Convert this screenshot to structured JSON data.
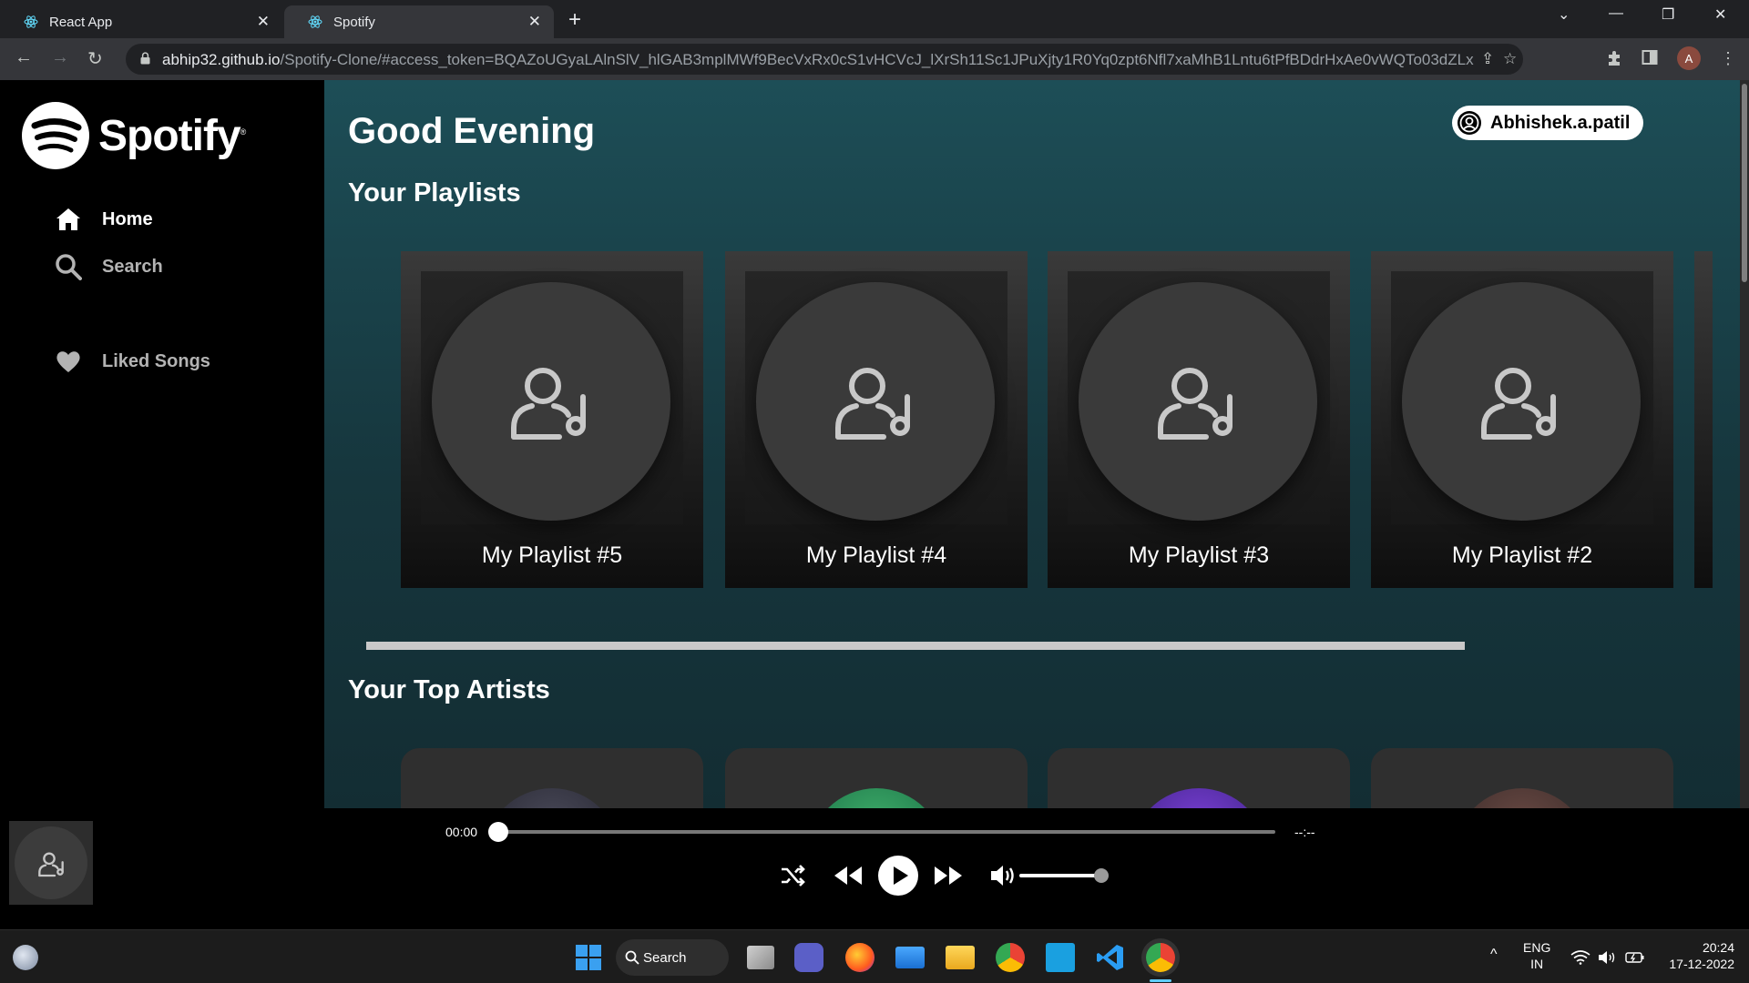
{
  "browser": {
    "tabs": [
      {
        "title": "React App",
        "active": false
      },
      {
        "title": "Spotify",
        "active": true
      }
    ],
    "url_host": "abhip32.github.io",
    "url_path": "/Spotify-Clone/#access_token=BQAZoUGyaLAlnSlV_hlGAB3mplMWf9BecVxRx0cS1vHCVcJ_lXrSh11Sc1JPuXjty1R0Yq0zpt6Nfl7xaMhB1Lntu6tPfBDdrHxAe0vWQTo03dZLxMGg...",
    "profile_initial": "A"
  },
  "sidebar": {
    "brand": "Spotify",
    "brand_mark": "®",
    "items": [
      {
        "label": "Home",
        "icon": "home-icon",
        "active": true
      },
      {
        "label": "Search",
        "icon": "search-icon",
        "active": false
      },
      {
        "label": "Liked Songs",
        "icon": "heart-icon",
        "active": false
      }
    ]
  },
  "main": {
    "greeting": "Good Evening",
    "user": "Abhishek.a.patil",
    "playlists_title": "Your Playlists",
    "playlists": [
      {
        "name": "My Playlist #5"
      },
      {
        "name": "My Playlist #4"
      },
      {
        "name": "My Playlist #3"
      },
      {
        "name": "My Playlist #2"
      }
    ],
    "artists_title": "Your Top Artists"
  },
  "player": {
    "current_time": "00:00",
    "total_time": "--:--",
    "progress": 0,
    "volume": 1.0
  },
  "taskbar": {
    "search_label": "Search",
    "lang": "ENG",
    "region": "IN",
    "time": "20:24",
    "date": "17-12-2022"
  },
  "colors": {
    "main_bg_top": "#1d4e57",
    "main_bg_bottom": "#132d33",
    "sidebar_bg": "#000000",
    "active_text": "#ffffff",
    "inactive_text": "#b3b3b3"
  }
}
